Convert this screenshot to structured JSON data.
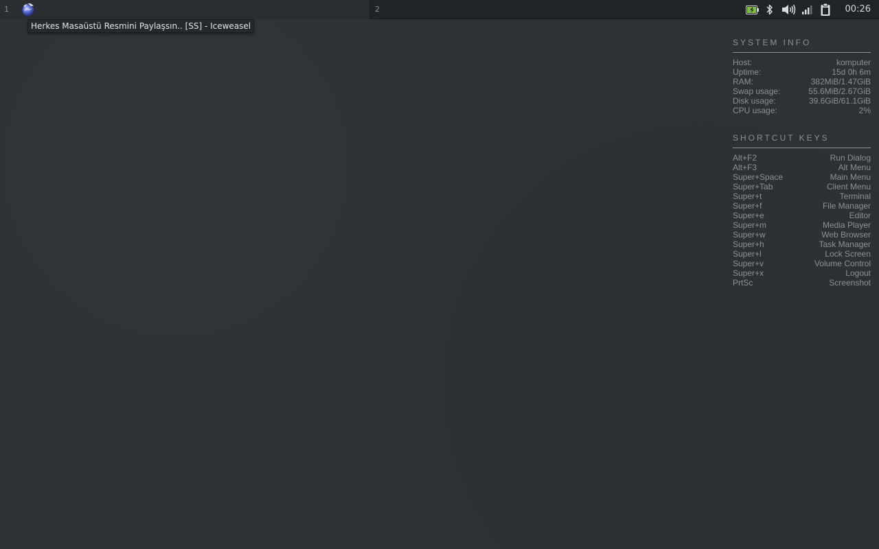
{
  "panel": {
    "desktops": [
      {
        "number": "1"
      },
      {
        "number": "2"
      }
    ],
    "app_icon": "iceweasel-globe-icon",
    "tray": {
      "icons": [
        "battery-icon",
        "bluetooth-icon",
        "volume-icon",
        "signal-icon",
        "clipboard-icon"
      ],
      "clock": "00:26"
    }
  },
  "tooltip": {
    "text": "Herkes Masaüstü Resmini Paylaşsın.. [SS] - Iceweasel"
  },
  "system_info": {
    "title": "SYSTEM INFO",
    "rows": [
      {
        "label": "Host:",
        "value": "komputer"
      },
      {
        "label": "Uptime:",
        "value": "15d 0h 6m"
      },
      {
        "label": "RAM:",
        "value": "382MiB/1.47GiB"
      },
      {
        "label": "Swap usage:",
        "value": "55.6MiB/2.67GiB"
      },
      {
        "label": "Disk usage:",
        "value": "39.6GiB/61.1GiB"
      },
      {
        "label": "CPU usage:",
        "value": "2%"
      }
    ]
  },
  "shortcut_keys": {
    "title": "SHORTCUT KEYS",
    "rows": [
      {
        "key": "Alt+F2",
        "action": "Run Dialog"
      },
      {
        "key": "Alt+F3",
        "action": "Alt Menu"
      },
      {
        "key": "Super+Space",
        "action": "Main Menu"
      },
      {
        "key": "Super+Tab",
        "action": "Client Menu"
      },
      {
        "key": "Super+t",
        "action": "Terminal"
      },
      {
        "key": "Super+f",
        "action": "File Manager"
      },
      {
        "key": "Super+e",
        "action": "Editor"
      },
      {
        "key": "Super+m",
        "action": "Media Player"
      },
      {
        "key": "Super+w",
        "action": "Web Browser"
      },
      {
        "key": "Super+h",
        "action": "Task Manager"
      },
      {
        "key": "Super+l",
        "action": "Lock Screen"
      },
      {
        "key": "Super+v",
        "action": "Volume Control"
      },
      {
        "key": "Super+x",
        "action": "Logout"
      },
      {
        "key": "PrtSc",
        "action": "Screenshot"
      }
    ]
  },
  "colors": {
    "panel": "#212426",
    "desktop": "#2e3235",
    "conky_text": "#8c9194",
    "battery_green": "#7fc241"
  }
}
